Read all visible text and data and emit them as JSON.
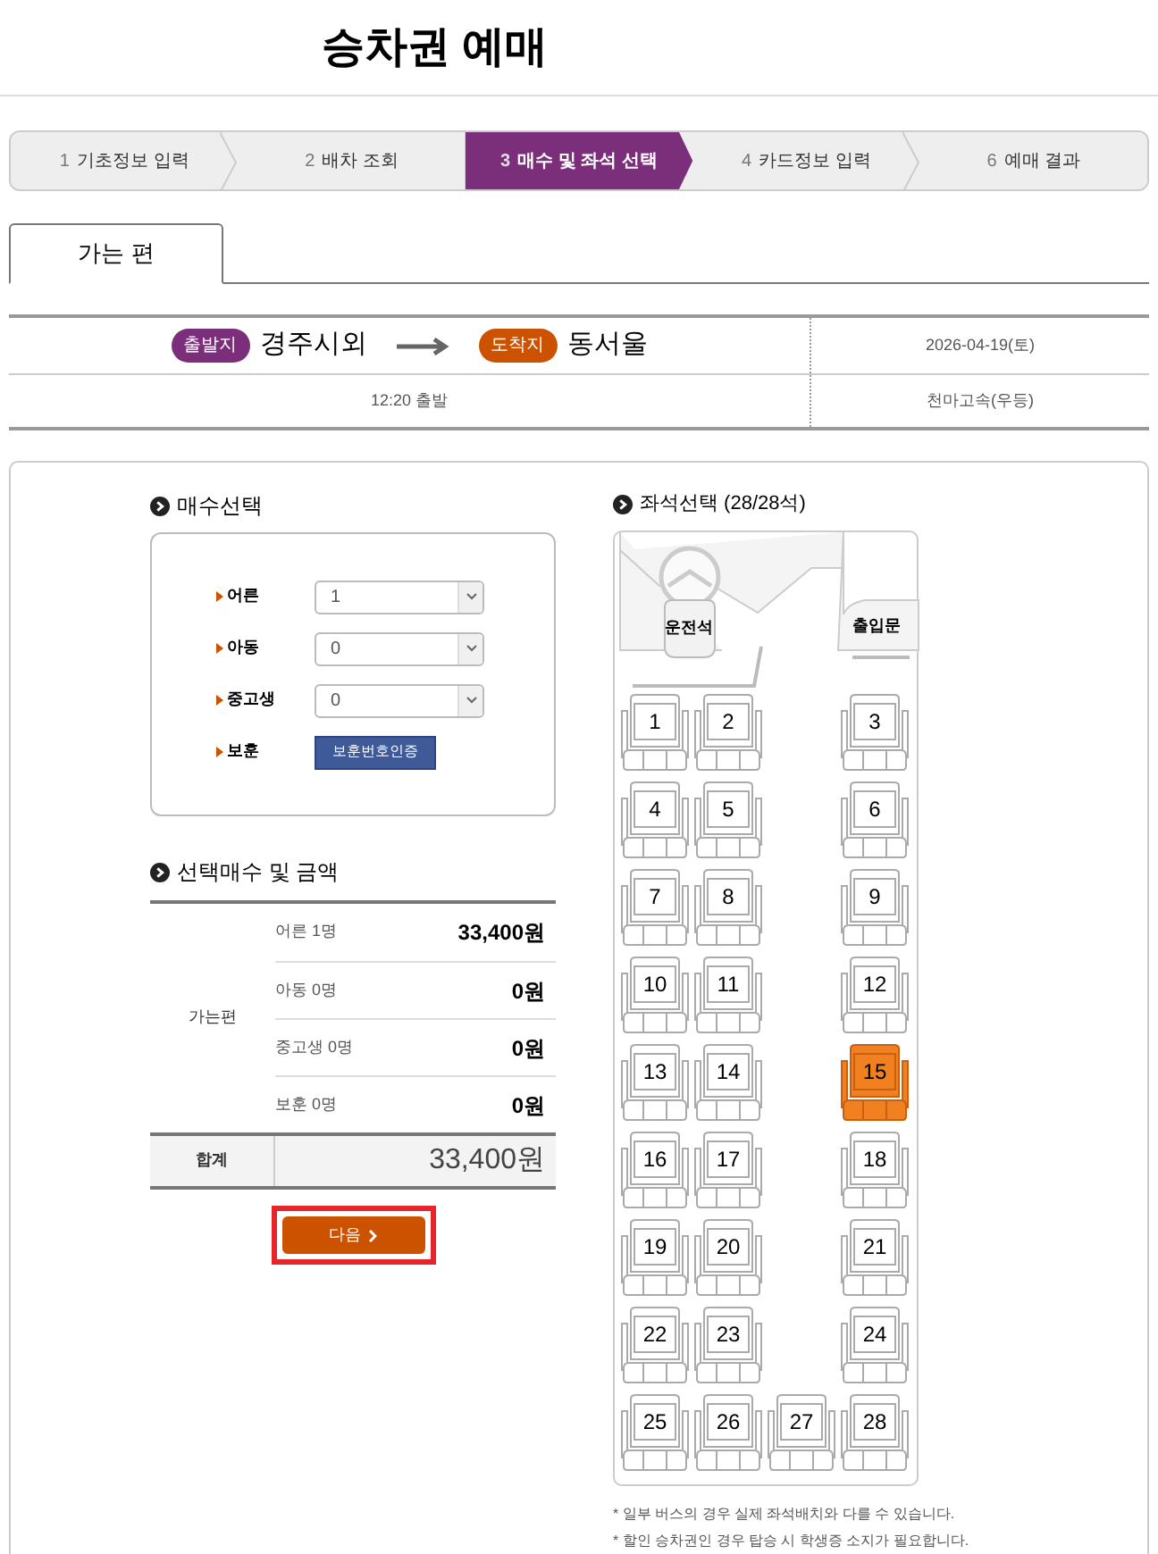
{
  "title": "승차권 예매",
  "steps": [
    {
      "number": "1",
      "label": "기초정보 입력",
      "selected": false
    },
    {
      "number": "2",
      "label": "배차 조회",
      "selected": false
    },
    {
      "number": "3",
      "label": "매수 및 좌석 선택",
      "selected": true
    },
    {
      "number": "4",
      "label": "카드정보 입력",
      "selected": false
    },
    {
      "number": "6",
      "label": "예매 결과",
      "selected": false
    }
  ],
  "direction_tabs": [
    {
      "label": "가는 편",
      "selected": true
    }
  ],
  "route": {
    "departure_badge": "출발지",
    "departure": "경주시외",
    "arrival_badge": "도착지",
    "arrival": "동서울",
    "date": "2026-04-19(토)",
    "time": "12:20 출발",
    "bus_company": "천마고속(우등)"
  },
  "count_section": {
    "heading": "매수선택",
    "rows": [
      {
        "kind": "select",
        "label": "어른",
        "value": "1"
      },
      {
        "kind": "select",
        "label": "아동",
        "value": "0"
      },
      {
        "kind": "select",
        "label": "중고생",
        "value": "0"
      },
      {
        "kind": "button",
        "label": "보훈",
        "button": "보훈번호인증"
      }
    ]
  },
  "fare_section": {
    "heading": "선택매수 및 금액",
    "direction": "가는편",
    "rows": [
      {
        "label": "어른 1명",
        "amount": "33,400원"
      },
      {
        "label": "아동 0명",
        "amount": "0원"
      },
      {
        "label": "중고생 0명",
        "amount": "0원"
      },
      {
        "label": "보훈 0명",
        "amount": "0원"
      }
    ],
    "total_label": "합계",
    "total": "33,400원"
  },
  "next_button": "다음",
  "seat_section": {
    "heading": "좌석선택 (28/28석)",
    "driver_label": "운전석",
    "door_label": "출입문",
    "rows": [
      [
        {
          "number": "1",
          "selected": false
        },
        {
          "number": "2",
          "selected": false
        },
        {
          "number": "3",
          "selected": false
        }
      ],
      [
        {
          "number": "4",
          "selected": false
        },
        {
          "number": "5",
          "selected": false
        },
        {
          "number": "6",
          "selected": false
        }
      ],
      [
        {
          "number": "7",
          "selected": false
        },
        {
          "number": "8",
          "selected": false
        },
        {
          "number": "9",
          "selected": false
        }
      ],
      [
        {
          "number": "10",
          "selected": false
        },
        {
          "number": "11",
          "selected": false
        },
        {
          "number": "12",
          "selected": false
        }
      ],
      [
        {
          "number": "13",
          "selected": false
        },
        {
          "number": "14",
          "selected": false
        },
        {
          "number": "15",
          "selected": true
        }
      ],
      [
        {
          "number": "16",
          "selected": false
        },
        {
          "number": "17",
          "selected": false
        },
        {
          "number": "18",
          "selected": false
        }
      ],
      [
        {
          "number": "19",
          "selected": false
        },
        {
          "number": "20",
          "selected": false
        },
        {
          "number": "21",
          "selected": false
        }
      ],
      [
        {
          "number": "22",
          "selected": false
        },
        {
          "number": "23",
          "selected": false
        },
        {
          "number": "24",
          "selected": false
        }
      ],
      [
        {
          "number": "25",
          "selected": false
        },
        {
          "number": "26",
          "selected": false
        },
        {
          "number": "27",
          "selected": false
        },
        {
          "number": "28",
          "selected": false
        }
      ]
    ]
  },
  "notes": [
    "* 일부 버스의 경우 실제 좌석배치와 다를 수 있습니다.",
    "* 할인 승차권인 경우 탑승 시 학생증 소지가 필요합니다."
  ]
}
